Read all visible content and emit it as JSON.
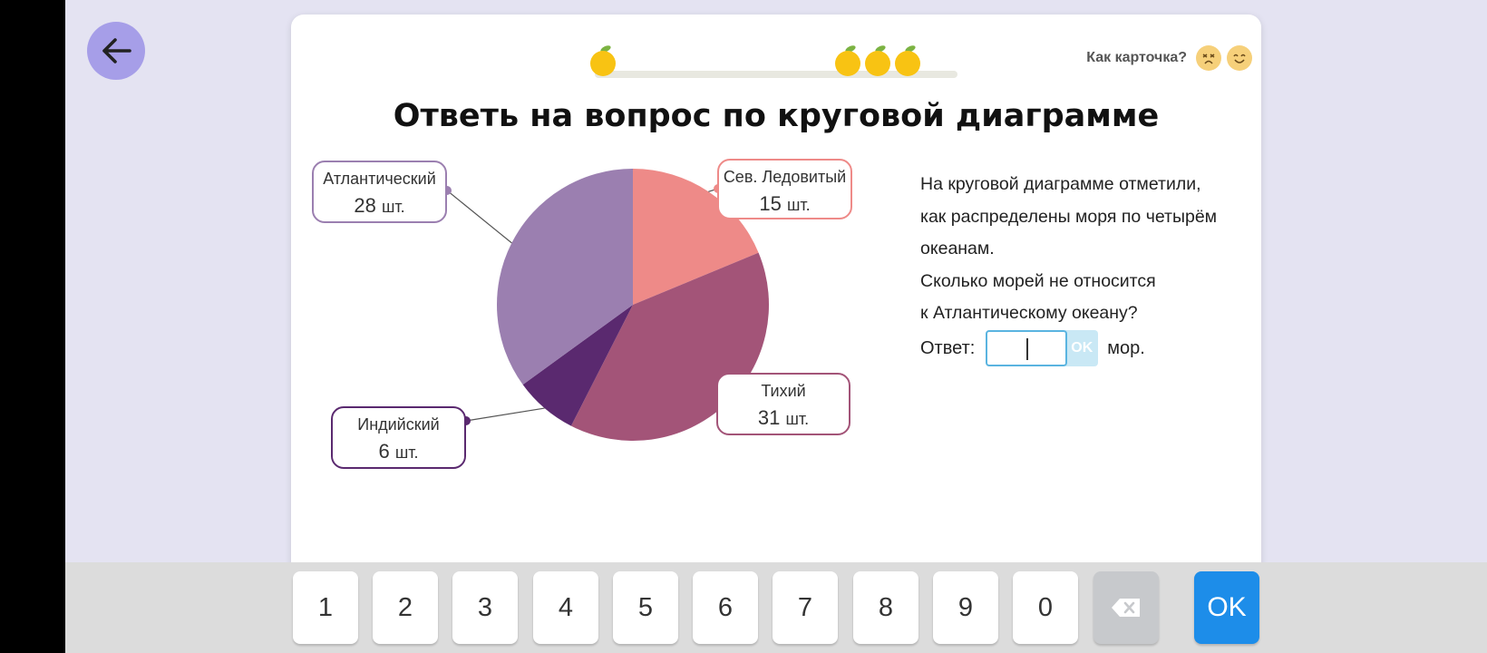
{
  "colors": {
    "app_bg": "#e4e3f2",
    "back_button": "#a69ee8",
    "arctic": "#ee8a88",
    "pacific": "#a35478",
    "indian": "#5a296f",
    "atlantic": "#9b7fb0"
  },
  "header": {
    "back_icon": "arrow-left-icon",
    "rating_label": "Как карточка?",
    "rating_icons": [
      "sad-face-icon",
      "smile-face-icon"
    ],
    "progress_icons": [
      "orange-icon",
      "orange-icon",
      "orange-icon",
      "orange-icon"
    ]
  },
  "card": {
    "title": "Ответь на вопрос по круговой диаграмме",
    "question_lines": [
      "На круговой диаграмме отметили,",
      "как распределены моря по четырём",
      "океанам.",
      "Сколько морей не относится",
      "к Атлантическому океану?"
    ],
    "answer_label": "Ответ:",
    "answer_value": "",
    "answer_ok": "OK",
    "answer_unit": "мор."
  },
  "chart_data": {
    "type": "pie",
    "unit": "шт.",
    "slices": [
      {
        "label": "Сев. Ледовитый",
        "value": 15,
        "color": "#ee8a88"
      },
      {
        "label": "Тихий",
        "value": 31,
        "color": "#a35478"
      },
      {
        "label": "Индийский",
        "value": 6,
        "color": "#5a296f"
      },
      {
        "label": "Атлантический",
        "value": 28,
        "color": "#9b7fb0"
      }
    ]
  },
  "keyboard": {
    "digits": [
      "1",
      "2",
      "3",
      "4",
      "5",
      "6",
      "7",
      "8",
      "9",
      "0"
    ],
    "backspace_icon": "backspace-icon",
    "ok_label": "OK"
  }
}
